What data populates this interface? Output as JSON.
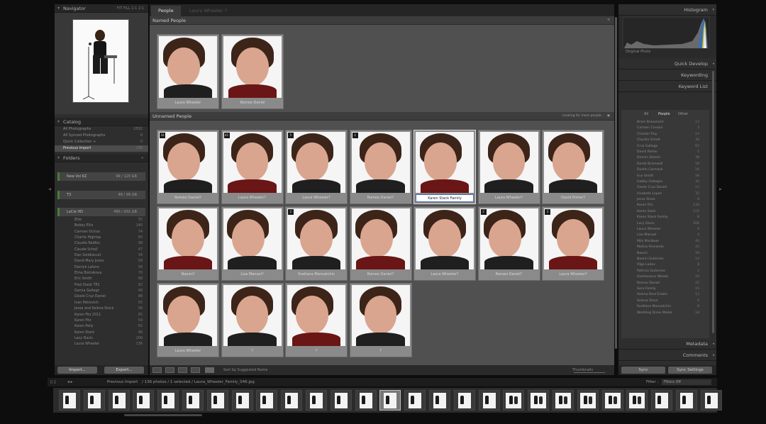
{
  "navigator": {
    "title": "Navigator",
    "zoom_options": [
      "FIT",
      "FILL",
      "1:1",
      "2:1"
    ]
  },
  "catalog": {
    "title": "Catalog",
    "items": [
      {
        "label": "All Photographs",
        "count": "2552"
      },
      {
        "label": "All Synced Photographs",
        "count": "0"
      },
      {
        "label": "Quick Collection +",
        "count": "0"
      },
      {
        "label": "Previous Import",
        "count": "136"
      }
    ]
  },
  "folders": {
    "title": "Folders",
    "volumes": [
      {
        "label": "New Vol KZ",
        "count": "99 / 120 GB"
      },
      {
        "label": "T3",
        "count": "48 / 99 GB"
      },
      {
        "label": "LaCie HD",
        "count": "490 / 931 GB"
      }
    ],
    "rows": [
      {
        "label": "Ellie",
        "count": "55"
      },
      {
        "label": "Bobby Ellis",
        "count": "140"
      },
      {
        "label": "Carmen Ochoa",
        "count": "74"
      },
      {
        "label": "Charlie Hightop",
        "count": "65"
      },
      {
        "label": "Claudia Redfox",
        "count": "98"
      },
      {
        "label": "Claude Schell",
        "count": "47"
      },
      {
        "label": "Dan Soldbiscuit",
        "count": "34"
      },
      {
        "label": "David Mary Jones",
        "count": "58"
      },
      {
        "label": "Derrick Lafonn",
        "count": "56"
      },
      {
        "label": "Elina Bistrakova",
        "count": "70"
      },
      {
        "label": "Eric Smith",
        "count": "68"
      },
      {
        "label": "Fred Stack TP2",
        "count": "92"
      },
      {
        "label": "Garcia Gallego",
        "count": "49"
      },
      {
        "label": "Gisele Cruz Daniel",
        "count": "88"
      },
      {
        "label": "Ivan Petrovich",
        "count": "55"
      },
      {
        "label": "Jesse and Selena Stock",
        "count": "56"
      },
      {
        "label": "Karen Fitz 2011",
        "count": "65"
      },
      {
        "label": "Karen Fitz",
        "count": "54"
      },
      {
        "label": "Karen Pally",
        "count": "81"
      },
      {
        "label": "Karen Stark",
        "count": "90"
      },
      {
        "label": "Lacy Davis",
        "count": "206"
      },
      {
        "label": "Laura Wheeler",
        "count": "136"
      }
    ],
    "import_label": "Import...",
    "export_label": "Export..."
  },
  "tabs": {
    "people": "People",
    "breadcrumb": "Laura Wheeler ?"
  },
  "named": {
    "title": "Named People",
    "people": [
      {
        "label": "Laura Wheeler"
      },
      {
        "label": "Romeo Daniel"
      }
    ]
  },
  "unnamed": {
    "title": "Unnamed People",
    "status": "Looking for more people...",
    "faces": [
      {
        "label": "Romeo Daniel?",
        "badge": "16"
      },
      {
        "label": "Laura Wheeler?",
        "badge": "42"
      },
      {
        "label": "Laura Wheeler?",
        "badge": "5"
      },
      {
        "label": "Romeo Daniel?",
        "badge": "2"
      },
      {
        "label": "Karen Stack Family",
        "badge": ""
      },
      {
        "label": "Laura Wheeler?",
        "badge": ""
      },
      {
        "label": "David Porter?",
        "badge": ""
      },
      {
        "label": "Naomi?",
        "badge": ""
      },
      {
        "label": "Lisa Manuel?",
        "badge": ""
      },
      {
        "label": "Svetlana Manuelchin",
        "badge": "2"
      },
      {
        "label": "Romeo Daniel?",
        "badge": ""
      },
      {
        "label": "Laura Wheeler?",
        "badge": ""
      },
      {
        "label": "Romeo Daniel?",
        "badge": "2"
      },
      {
        "label": "Laura Wheeler?",
        "badge": "3"
      },
      {
        "label": "Laura Wheeler",
        "badge": ""
      },
      {
        "label": "?",
        "badge": ""
      },
      {
        "label": "?",
        "badge": ""
      },
      {
        "label": "?",
        "badge": ""
      }
    ]
  },
  "toolbar": {
    "sort_label": "Sort by Suggested Name",
    "thumbnails_label": "Thumbnails"
  },
  "right_panel": {
    "histogram_title": "Histogram",
    "original_photo": "Original Photo",
    "quick_develop": "Quick Develop",
    "keywording": "Keywording",
    "keyword_list": "Keyword List",
    "keyword_tabs": [
      "All",
      "People",
      "Other"
    ],
    "keywords": [
      {
        "label": "Bram Beaumont",
        "count": "12"
      },
      {
        "label": "Carmen Cavazo",
        "count": "3"
      },
      {
        "label": "Chantal Troy",
        "count": "14"
      },
      {
        "label": "Claudia Schelt",
        "count": "34"
      },
      {
        "label": "Cruz Gallego",
        "count": "87"
      },
      {
        "label": "David Parker",
        "count": "5"
      },
      {
        "label": "Dennis Deloch",
        "count": "38"
      },
      {
        "label": "Derek Bromwell",
        "count": "18"
      },
      {
        "label": "Dustin Cormack",
        "count": "16"
      },
      {
        "label": "Eva Smith",
        "count": "58"
      },
      {
        "label": "Gabby Gallegos",
        "count": "32"
      },
      {
        "label": "Gisele Cruz Daniel",
        "count": "12"
      },
      {
        "label": "Irisabeta Lopez",
        "count": "32"
      },
      {
        "label": "Jesse Stack",
        "count": "8"
      },
      {
        "label": "Karen Fitz",
        "count": "134"
      },
      {
        "label": "Karen Stark",
        "count": "112"
      },
      {
        "label": "Karen Stack Family",
        "count": "8"
      },
      {
        "label": "Lacy Davis",
        "count": "206"
      },
      {
        "label": "Laura Wheeler",
        "count": "4"
      },
      {
        "label": "Lisa Manuel",
        "count": "4"
      },
      {
        "label": "Mila Mariboer",
        "count": "40"
      },
      {
        "label": "Molina Fernando",
        "count": "33"
      },
      {
        "label": "Naomi",
        "count": "18"
      },
      {
        "label": "Naomi Gutierrez",
        "count": "14"
      },
      {
        "label": "Olga Ladov",
        "count": "8"
      },
      {
        "label": "Patricio Gutierrez",
        "count": "2"
      },
      {
        "label": "Quintavious Woods",
        "count": "24"
      },
      {
        "label": "Romeo Daniel",
        "count": "22"
      },
      {
        "label": "Sara Family",
        "count": "15"
      },
      {
        "label": "Selena Real Estate",
        "count": "12"
      },
      {
        "label": "Selena Stock",
        "count": "6"
      },
      {
        "label": "Svetlana Manuelchin",
        "count": "8"
      },
      {
        "label": "Wedding Dress Model",
        "count": "18"
      }
    ],
    "metadata": "Metadata",
    "comments": "Comments",
    "sync": "Sync",
    "sync_settings": "Sync Settings"
  },
  "filmstrip": {
    "source": "Previous Import",
    "info": "/ 136 photos / 1 selected / Laura_Wheeler_Family_046.jpg",
    "filter_label": "Filter :",
    "filter_value": "Filters Off"
  }
}
